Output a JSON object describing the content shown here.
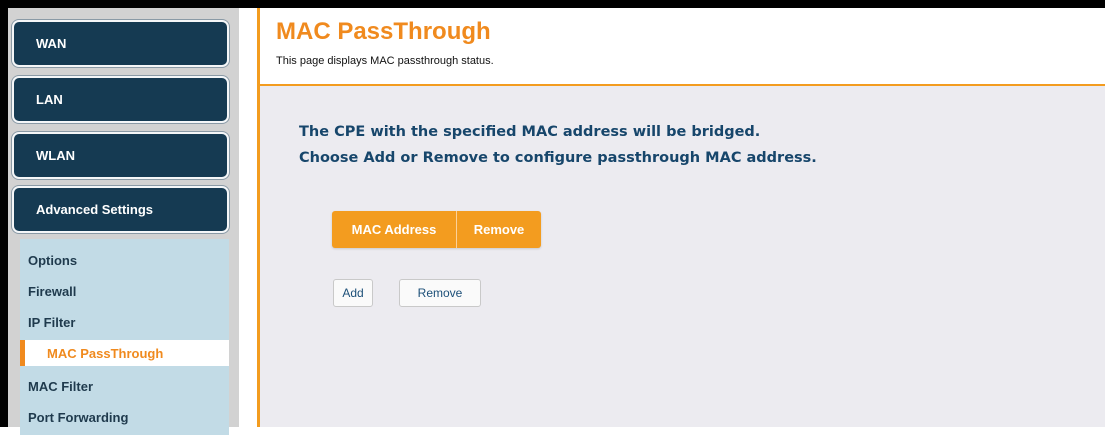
{
  "sidebar": {
    "main_items": [
      {
        "label": "WAN"
      },
      {
        "label": "LAN"
      },
      {
        "label": "WLAN"
      },
      {
        "label": "Advanced Settings"
      }
    ],
    "sub_items": [
      {
        "label": "Options"
      },
      {
        "label": "Firewall"
      },
      {
        "label": "IP Filter"
      },
      {
        "label": "MAC PassThrough",
        "active": true
      },
      {
        "label": "MAC Filter"
      },
      {
        "label": "Port Forwarding"
      }
    ]
  },
  "header": {
    "title": "MAC PassThrough",
    "subtitle": "This page displays MAC passthrough status."
  },
  "main": {
    "info_line1": "The CPE with the specified MAC address will be bridged.",
    "info_line2": "Choose Add or Remove to configure passthrough MAC address.",
    "table": {
      "columns": [
        "MAC Address",
        "Remove"
      ]
    },
    "buttons": {
      "add": "Add",
      "remove": "Remove"
    }
  },
  "colors": {
    "accent": "#f39c1f",
    "nav_dark": "#153a52",
    "submenu_bg": "#c2dbe6",
    "info_text": "#17466b"
  }
}
